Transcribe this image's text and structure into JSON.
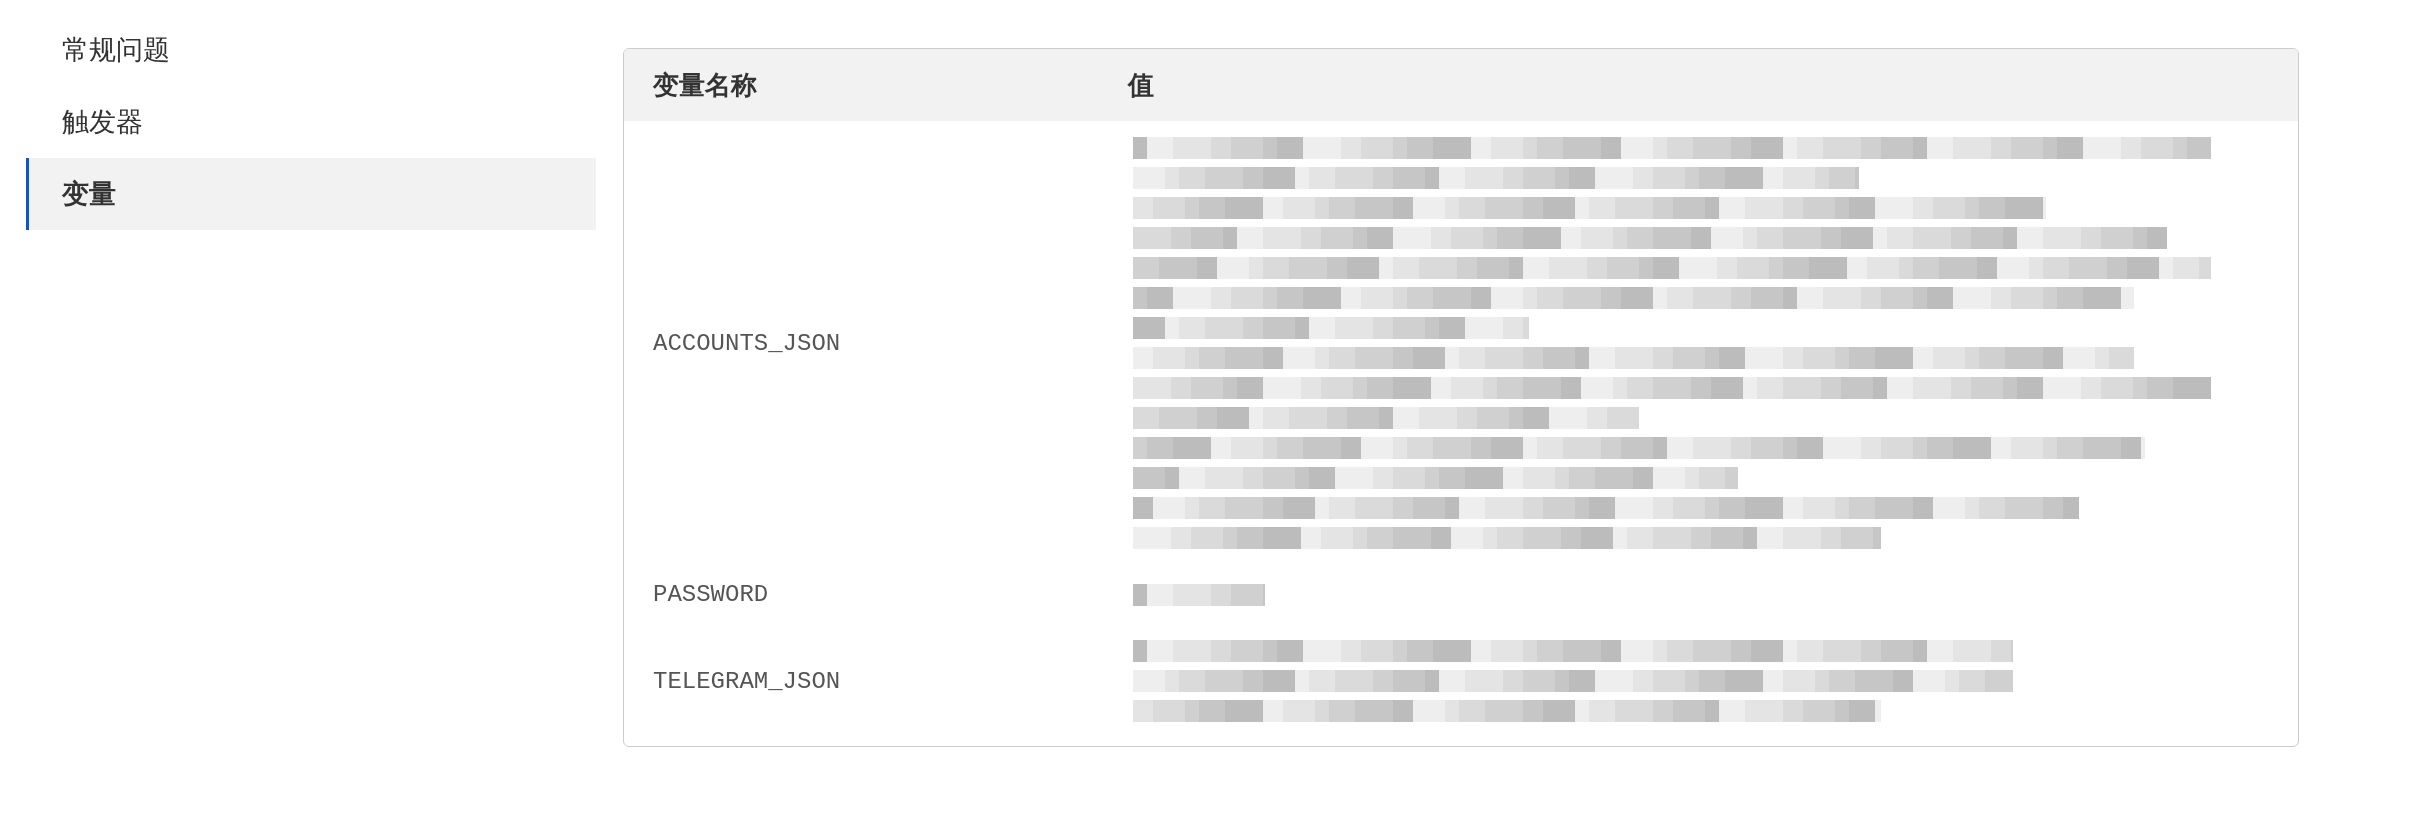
{
  "sidebar": {
    "items": [
      {
        "label": "常规问题",
        "selected": false
      },
      {
        "label": "触发器",
        "selected": false
      },
      {
        "label": "变量",
        "selected": true
      }
    ]
  },
  "table": {
    "columns": [
      "变量名称",
      "值"
    ],
    "rows": [
      {
        "name": "ACCOUNTS_JSON",
        "value": {
          "kind": "redacted"
        }
      },
      {
        "name": "PASSWORD",
        "value": {
          "kind": "redacted"
        }
      },
      {
        "name": "TELEGRAM_JSON",
        "value": {
          "kind": "redacted"
        }
      }
    ]
  }
}
